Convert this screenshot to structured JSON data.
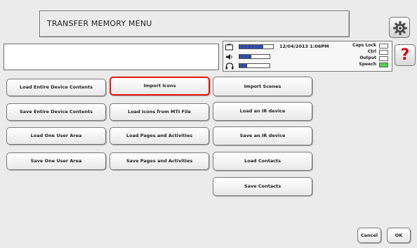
{
  "header": {
    "title": "TRANSFER MEMORY MENU"
  },
  "status": {
    "datetime": "12/04/2013 1:06PM",
    "meters": [
      {
        "name": "battery-icon",
        "level": 0.7
      },
      {
        "name": "speaker-icon",
        "level": 0.4
      },
      {
        "name": "headphones-icon",
        "level": 0.25
      }
    ],
    "indicators": [
      {
        "label": "Caps Lock",
        "on": false
      },
      {
        "label": "Ctrl",
        "on": false
      },
      {
        "label": "Output",
        "on": false
      },
      {
        "label": "Speech",
        "on": true
      }
    ]
  },
  "help_label": "?",
  "buttons": {
    "col1": [
      "Load Entire Device Contents",
      "Save Entire Device Contents",
      "Load One User Area",
      "Save One User Area"
    ],
    "col2": [
      "Import Icons",
      "Load Icons from MTI File",
      "Load Pages and Activities",
      "Save Pages and Activities"
    ],
    "col3": [
      "Import Scenes",
      "Load an IR device",
      "Save an IR device",
      "Load Contacts",
      "Save Contacts"
    ],
    "selected": "Import Icons"
  },
  "footer": {
    "cancel": "Cancel",
    "ok": "OK"
  },
  "colors": {
    "selected_border": "#e01818",
    "speech_on": "#4fd24f",
    "help": "#d01020"
  }
}
